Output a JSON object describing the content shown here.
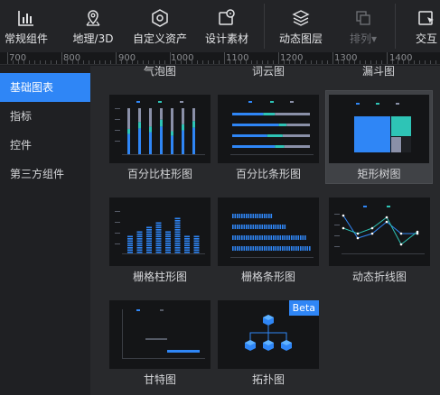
{
  "toolbar": {
    "items": [
      {
        "label": "常规组件",
        "icon": "bar-chart-icon"
      },
      {
        "label": "地理/3D",
        "icon": "map-pin-icon"
      },
      {
        "label": "自定义资产",
        "icon": "hexagon-icon"
      },
      {
        "label": "设计素材",
        "icon": "image-pin-icon"
      },
      {
        "label": "动态图层",
        "icon": "layers-icon"
      },
      {
        "label": "排列▾",
        "icon": "arrange-icon"
      },
      {
        "label": "交互",
        "icon": "interaction-icon"
      }
    ]
  },
  "ruler": {
    "labels": [
      "700",
      "800",
      "900",
      "1000",
      "1100",
      "1200",
      "1300",
      "1400"
    ]
  },
  "sidebar": {
    "items": [
      {
        "label": "基础图表",
        "active": true
      },
      {
        "label": "指标",
        "active": false
      },
      {
        "label": "控件",
        "active": false
      },
      {
        "label": "第三方组件",
        "active": false
      }
    ]
  },
  "content": {
    "top_labels": [
      "气泡图",
      "词云图",
      "漏斗图"
    ],
    "cards": [
      {
        "label": "百分比柱形图",
        "thumb": "percent-column"
      },
      {
        "label": "百分比条形图",
        "thumb": "percent-bar"
      },
      {
        "label": "矩形树图",
        "thumb": "treemap",
        "selected": true
      },
      {
        "label": "栅格柱形图",
        "thumb": "grid-column"
      },
      {
        "label": "栅格条形图",
        "thumb": "grid-bar"
      },
      {
        "label": "动态折线图",
        "thumb": "dynamic-line"
      },
      {
        "label": "甘特图",
        "thumb": "gantt"
      },
      {
        "label": "拓扑图",
        "thumb": "topology",
        "badge": "Beta"
      }
    ]
  },
  "colors": {
    "accent": "#2f86f6",
    "teal": "#2ec4b6",
    "bar_gray": "#8a90a8"
  }
}
